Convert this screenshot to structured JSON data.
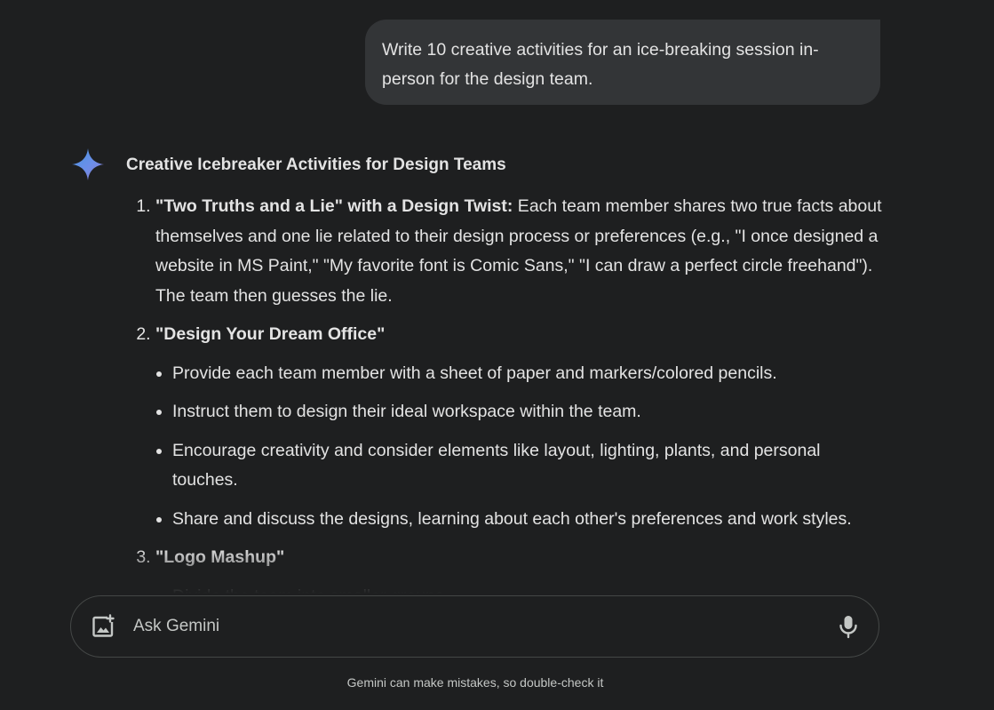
{
  "user_message": {
    "text": "Write 10 creative activities for an ice-breaking session in-person for the design team."
  },
  "response": {
    "title": "Creative Icebreaker Activities for Design Teams",
    "items": [
      {
        "heading": "\"Two Truths and a Lie\" with a Design Twist:",
        "body": " Each team member shares two true facts about themselves and one lie related to their design process or preferences (e.g., \"I once designed a website in MS Paint,\" \"My favorite font is Comic Sans,\" \"I can draw a perfect circle freehand\"). The team then guesses the lie."
      },
      {
        "heading": "\"Design Your Dream Office\"",
        "bullets": [
          "Provide each team member with a sheet of paper and markers/colored pencils.",
          "Instruct them to design their ideal workspace within the team.",
          "Encourage creativity and consider elements like layout, lighting, plants, and personal touches.",
          "Share and discuss the designs, learning about each other's preferences and work styles."
        ]
      },
      {
        "heading": "\"Logo Mashup\"",
        "bullets": [
          "Divide the team into smaller groups."
        ]
      }
    ]
  },
  "composer": {
    "placeholder": "Ask Gemini",
    "add_image_icon": "add-photo-icon",
    "mic_icon": "microphone-icon"
  },
  "disclaimer": "Gemini can make mistakes, so double-check it",
  "colors": {
    "background": "#1e1f20",
    "user_bubble": "#333537",
    "text": "#e3e3e3",
    "muted_text": "#c4c7c5",
    "border": "#444746",
    "gemini_blue": "#4796e3",
    "gemini_purple": "#9177c7"
  }
}
